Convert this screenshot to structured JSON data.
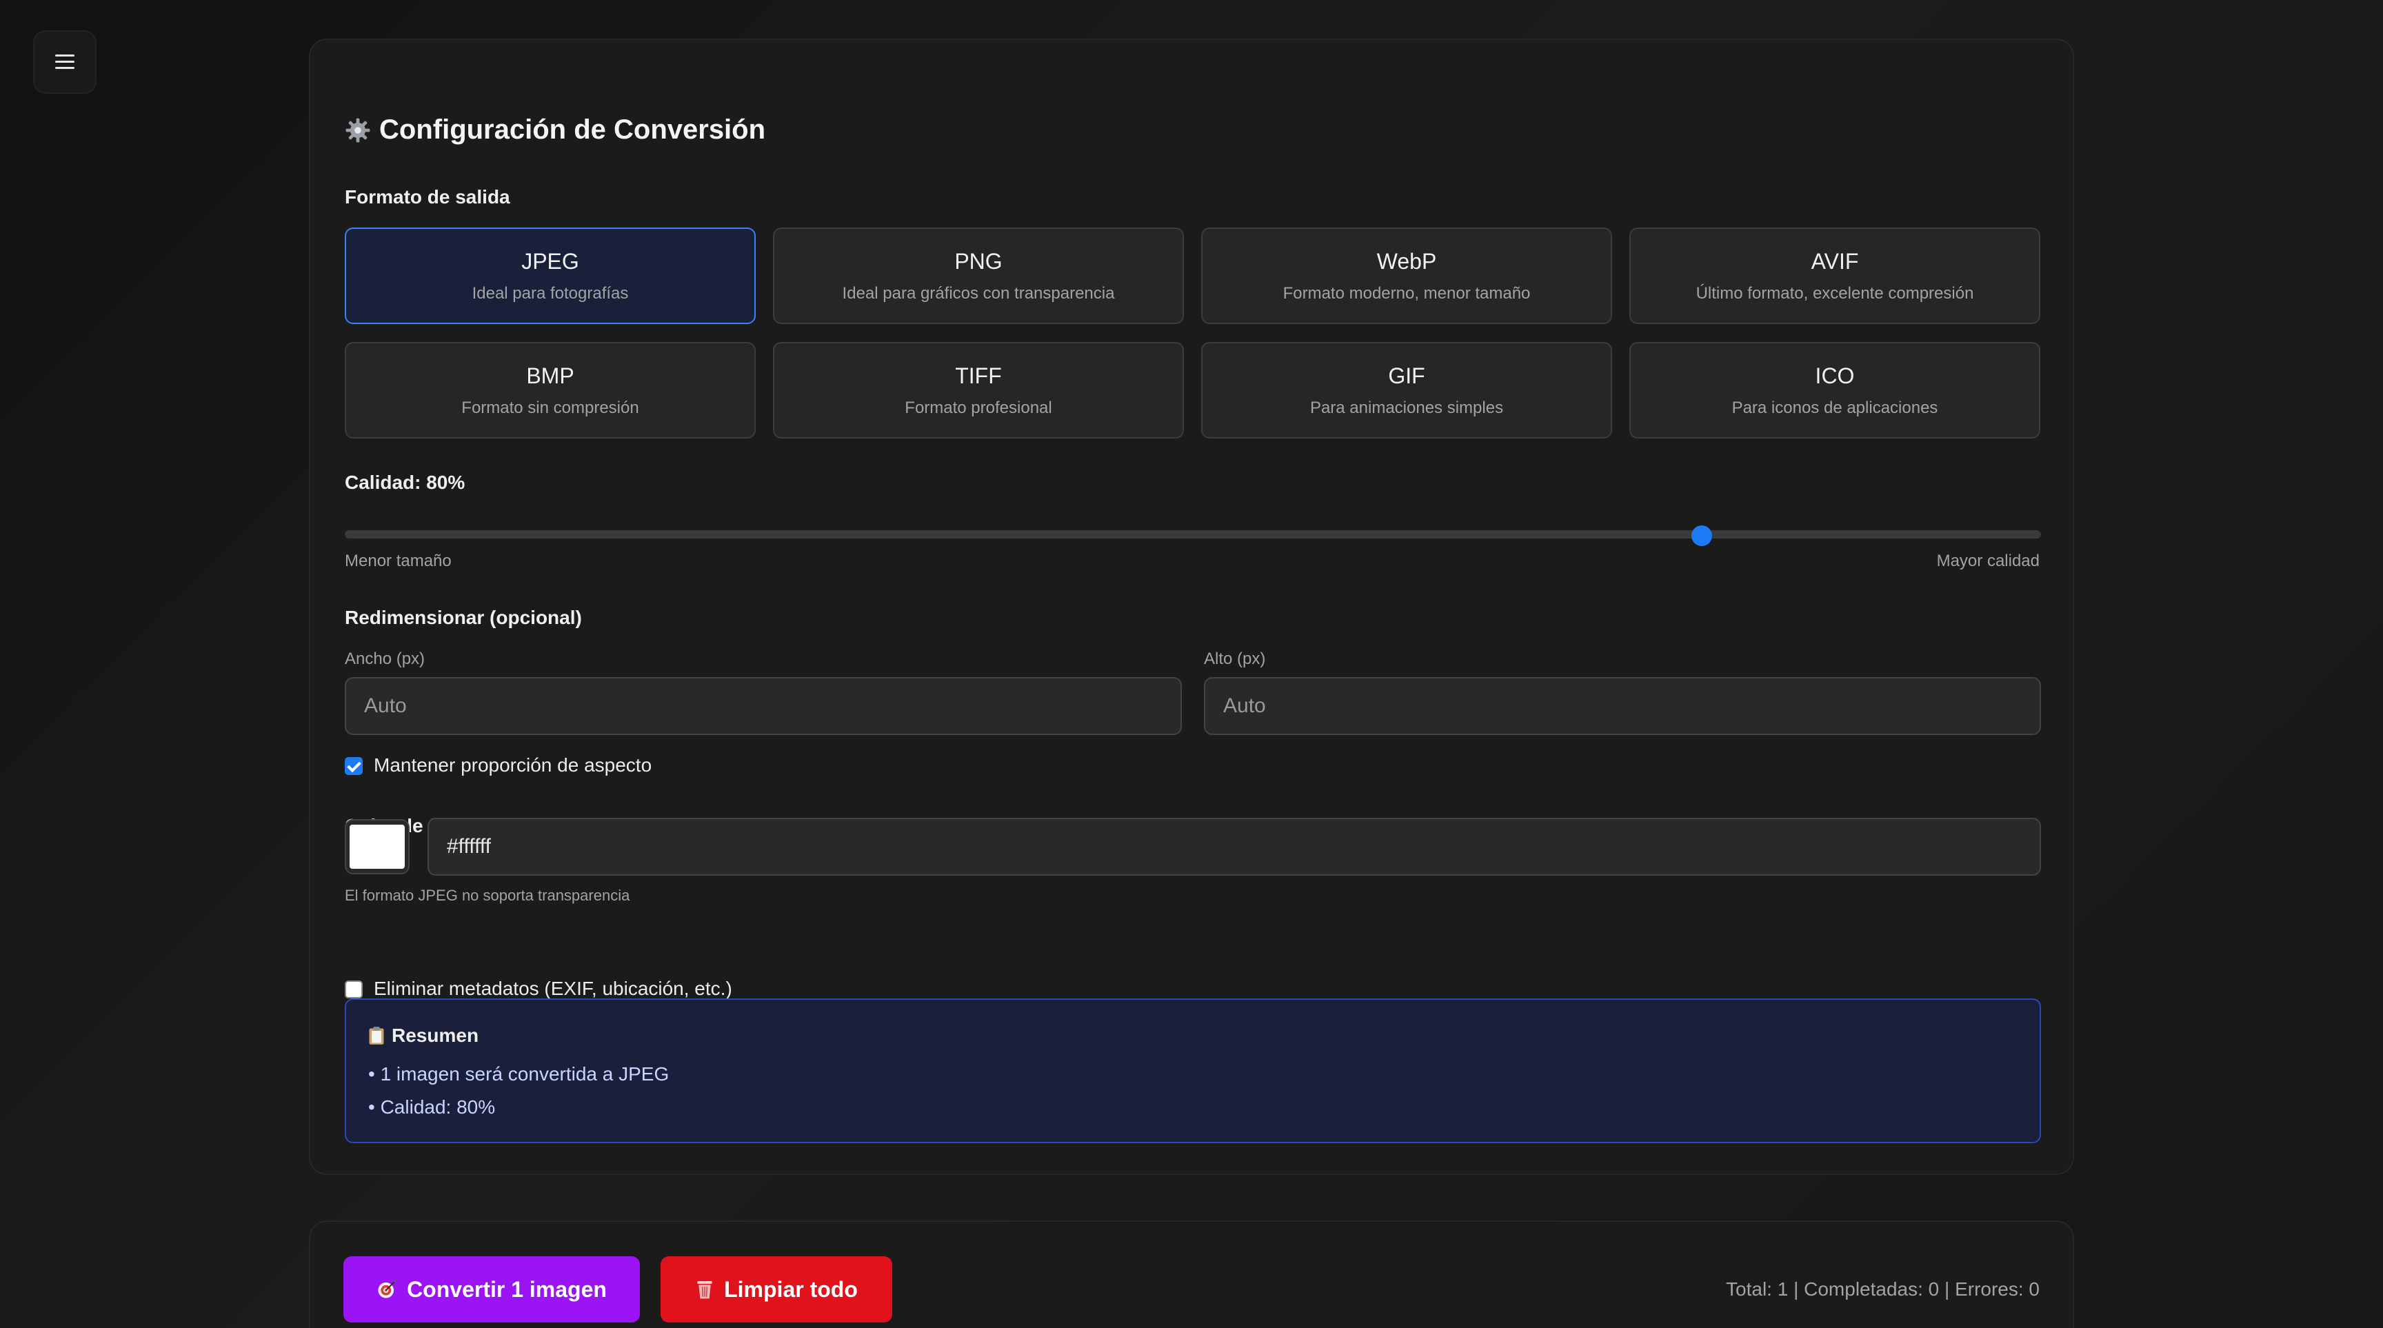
{
  "menu": {
    "icon": "hamburger-menu-icon"
  },
  "settings": {
    "title": "Configuración de Conversión",
    "title_icon": "gear-icon",
    "output_format_label": "Formato de salida",
    "formats": [
      {
        "name": "JPEG",
        "desc": "Ideal para fotografías",
        "selected": true
      },
      {
        "name": "PNG",
        "desc": "Ideal para gráficos con transparencia",
        "selected": false
      },
      {
        "name": "WebP",
        "desc": "Formato moderno, menor tamaño",
        "selected": false
      },
      {
        "name": "AVIF",
        "desc": "Último formato, excelente compresión",
        "selected": false
      },
      {
        "name": "BMP",
        "desc": "Formato sin compresión",
        "selected": false
      },
      {
        "name": "TIFF",
        "desc": "Formato profesional",
        "selected": false
      },
      {
        "name": "GIF",
        "desc": "Para animaciones simples",
        "selected": false
      },
      {
        "name": "ICO",
        "desc": "Para iconos de aplicaciones",
        "selected": false
      }
    ],
    "quality": {
      "label": "Calidad: 80%",
      "value": 80,
      "min_label": "Menor tamaño",
      "max_label": "Mayor calidad"
    },
    "resize": {
      "label": "Redimensionar (opcional)",
      "width_label": "Ancho (px)",
      "width_placeholder": "Auto",
      "height_label": "Alto (px)",
      "height_placeholder": "Auto",
      "keep_ratio_label": "Mantener proporción de aspecto",
      "keep_ratio_checked": true
    },
    "background": {
      "label": "Color de fondo",
      "color_value": "#ffffff",
      "note": "El formato JPEG no soporta transparencia"
    },
    "strip_metadata": {
      "label": "Eliminar metadatos (EXIF, ubicación, etc.)",
      "checked": false
    },
    "summary": {
      "title": "Resumen",
      "icon": "clipboard-icon",
      "lines": [
        "• 1 imagen será convertida a JPEG",
        "• Calidad: 80%"
      ]
    }
  },
  "actions": {
    "convert_label": "Convertir 1 imagen",
    "convert_icon": "target-icon",
    "clear_label": "Limpiar todo",
    "clear_icon": "trash-icon",
    "stats": "Total: 1 | Completadas: 0 | Errores: 0"
  },
  "colors": {
    "accent_blue": "#1d7bf5",
    "convert_purple": "#9b14f5",
    "clear_red": "#e0121b"
  }
}
